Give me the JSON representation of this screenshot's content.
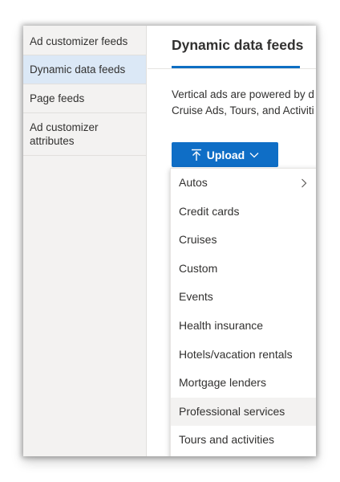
{
  "sidebar": {
    "items": [
      {
        "label": "Ad customizer feeds",
        "active": false
      },
      {
        "label": "Dynamic data feeds",
        "active": true
      },
      {
        "label": "Page feeds",
        "active": false
      },
      {
        "label": "Ad customizer attributes",
        "active": false
      }
    ]
  },
  "main": {
    "tab_title": "Dynamic data feeds",
    "description_line1": "Vertical ads are powered by d",
    "description_line2": "Cruise Ads, Tours, and Activiti"
  },
  "upload": {
    "label": "Upload",
    "icon_left": "upload-arrow-icon",
    "icon_right": "chevron-down-icon"
  },
  "menu": {
    "items": [
      {
        "label": "Autos",
        "has_submenu": true
      },
      {
        "label": "Credit cards"
      },
      {
        "label": "Cruises"
      },
      {
        "label": "Custom"
      },
      {
        "label": "Events"
      },
      {
        "label": "Health insurance"
      },
      {
        "label": "Hotels/vacation rentals"
      },
      {
        "label": "Mortgage lenders"
      },
      {
        "label": "Professional services",
        "hovered": true
      },
      {
        "label": "Tours and activities"
      }
    ]
  },
  "colors": {
    "accent": "#0f6ec6",
    "sidebar_bg": "#f3f2f1",
    "sidebar_active": "#dbe8f6",
    "text": "#323130",
    "hover": "#f3f2f1"
  }
}
